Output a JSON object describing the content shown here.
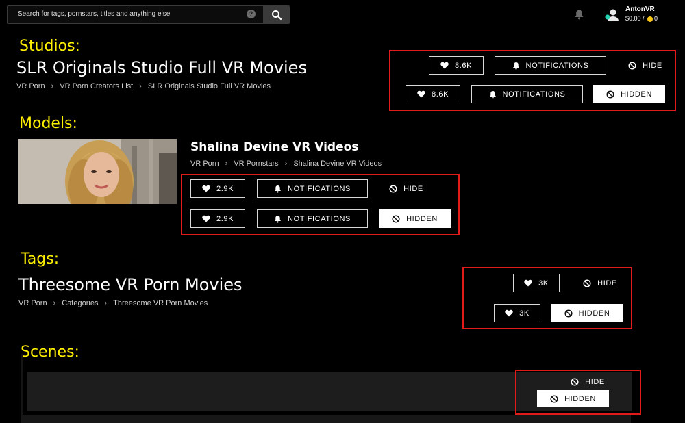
{
  "header": {
    "search_placeholder": "Search for tags, pornstars, titles and anything else",
    "username": "AntonVR",
    "balance": "$0.00 /",
    "coins": "0"
  },
  "sections": {
    "studios": {
      "label": "Studios:",
      "title": "SLR Originals Studio Full VR Movies",
      "breadcrumb": [
        "VR Porn",
        "VR Porn Creators List",
        "SLR Originals Studio Full VR Movies"
      ],
      "likes": "8.6K",
      "notifications_label": "NOTIFICATIONS",
      "hide_label": "HIDE",
      "hidden_label": "HIDDEN"
    },
    "models": {
      "label": "Models:",
      "title": "Shalina Devine VR Videos",
      "breadcrumb": [
        "VR Porn",
        "VR Pornstars",
        "Shalina Devine VR Videos"
      ],
      "likes": "2.9K",
      "notifications_label": "NOTIFICATIONS",
      "hide_label": "HIDE",
      "hidden_label": "HIDDEN"
    },
    "tags": {
      "label": "Tags:",
      "title": "Threesome VR Porn Movies",
      "breadcrumb": [
        "VR Porn",
        "Categories",
        "Threesome VR Porn Movies"
      ],
      "likes": "3K",
      "hide_label": "HIDE",
      "hidden_label": "HIDDEN"
    },
    "scenes": {
      "label": "Scenes:",
      "hide_label": "HIDE",
      "hidden_label": "HIDDEN"
    }
  },
  "colors": {
    "label_yellow": "#ffef00",
    "highlight_red": "#e11a1a",
    "coin": "#f5c518"
  },
  "icons": [
    "search-icon",
    "help-icon",
    "bell-icon",
    "user-avatar-icon",
    "heart-icon",
    "bell-icon",
    "ban-icon"
  ]
}
